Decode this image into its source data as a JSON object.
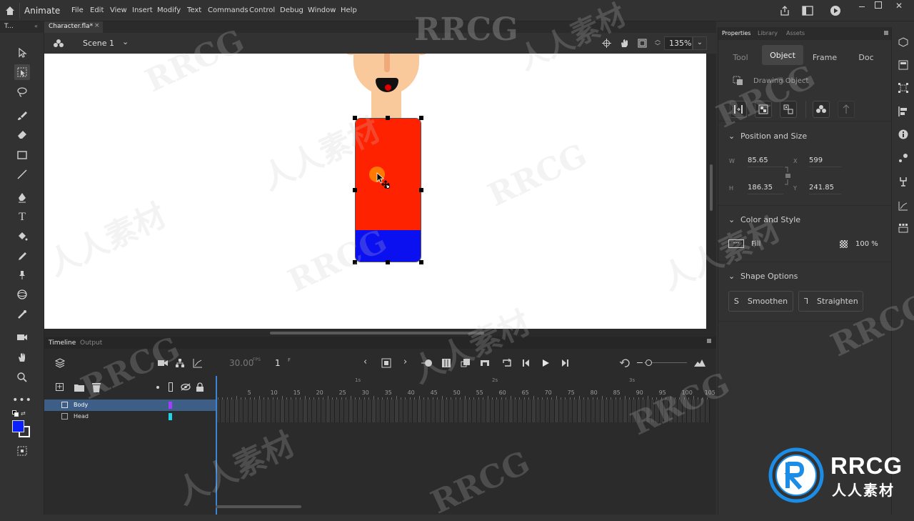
{
  "app": {
    "name": "Animate"
  },
  "menu": [
    "File",
    "Edit",
    "View",
    "Insert",
    "Modify",
    "Text",
    "Commands",
    "Control",
    "Debug",
    "Window",
    "Help"
  ],
  "tools_header": "T...",
  "document_tab": {
    "label": "Character.fla*",
    "close": "×"
  },
  "scene": {
    "label": "Scene 1",
    "zoom": "135%"
  },
  "timeline": {
    "tab_timeline": "Timeline",
    "tab_output": "Output",
    "fps": "30.00",
    "fps_unit": "FPS",
    "frame": "1",
    "frame_unit": "F",
    "seconds": [
      "1s",
      "2s",
      "3s"
    ],
    "frame_numbers": [
      "5",
      "10",
      "15",
      "20",
      "25",
      "30",
      "35",
      "40",
      "45",
      "50",
      "55",
      "60",
      "65",
      "70",
      "75",
      "80",
      "85",
      "90",
      "95",
      "100",
      "105"
    ],
    "layers": [
      {
        "name": "Body",
        "color": "#a040ff",
        "selected": true
      },
      {
        "name": "Head",
        "color": "#22d3e6",
        "selected": false
      }
    ]
  },
  "properties": {
    "tabs": [
      "Properties",
      "Library",
      "Assets"
    ],
    "subtabs": [
      "Tool",
      "Object",
      "Frame",
      "Doc"
    ],
    "active_subtab": "Object",
    "object_type": "Drawing Object",
    "position_size": {
      "title": "Position and Size",
      "w_label": "W",
      "w": "85.65",
      "h_label": "H",
      "h": "186.35",
      "x_label": "X",
      "x": "599",
      "y_label": "Y",
      "y": "241.85"
    },
    "color_style": {
      "title": "Color and Style",
      "fill_label": "Fill",
      "opacity": "100 %"
    },
    "shape_options": {
      "title": "Shape Options",
      "smoothen": "Smoothen",
      "straighten": "Straighten"
    }
  },
  "colors": {
    "body_red": "#ff2200",
    "body_blue": "#0b10f0",
    "skin": "#f9c99c",
    "accent": "#2a6ab8",
    "stroke_color": "#ffffff",
    "fill_color": "#0b20ff"
  },
  "watermark": {
    "logo_text": "RRCG",
    "logo_sub": "人人素材",
    "bg_text": "RRCG",
    "bg_sub": "人人素材"
  }
}
